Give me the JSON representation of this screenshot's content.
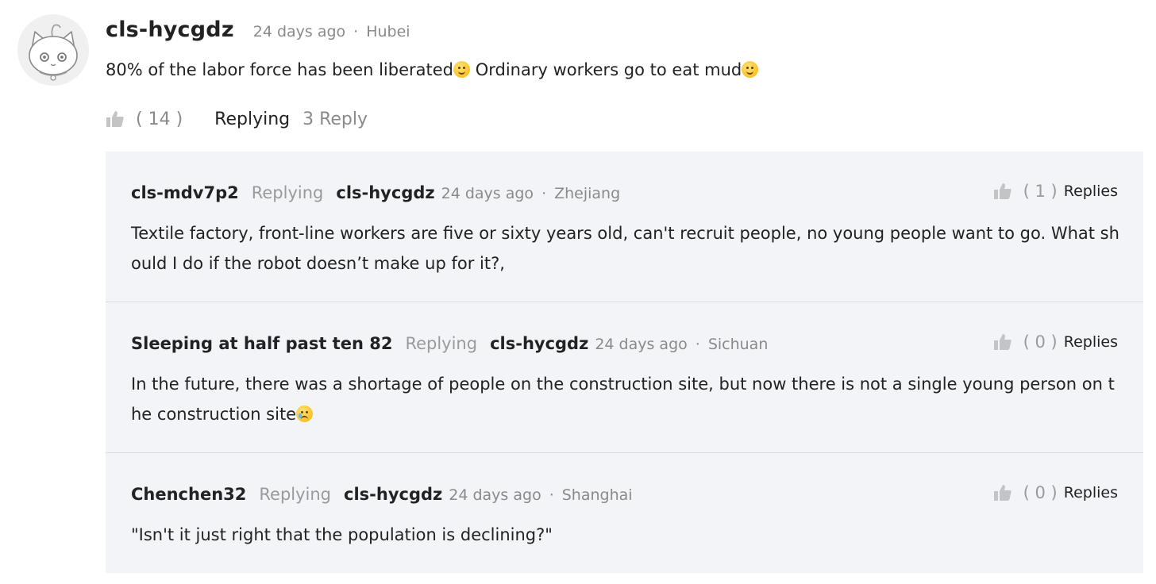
{
  "main_comment": {
    "username": "cls-hycgdz",
    "time": "24 days ago",
    "separator": "·",
    "location": "Hubei",
    "text_part1": "80% of the labor force has been liberated",
    "text_part2": " Ordinary workers go to eat mud",
    "like_count": "( 14 )",
    "replying_label": "Replying",
    "reply_count": "3 Reply"
  },
  "replies": [
    {
      "username": "cls-mdv7p2",
      "replying_label": "Replying",
      "target": "cls-hycgdz",
      "time": "24 days ago",
      "separator": "·",
      "location": "Zhejiang",
      "like_count": "( 1 )",
      "replies_label": "Replies",
      "text": "Textile factory, front-line workers are five or sixty years old, can't recruit people, no young people want to go. What should I do if the robot doesn’t make up for it?,"
    },
    {
      "username": "Sleeping at half past ten 82",
      "replying_label": "Replying",
      "target": "cls-hycgdz",
      "time": "24 days ago",
      "separator": "·",
      "location": "Sichuan",
      "like_count": "( 0 )",
      "replies_label": "Replies",
      "text": "In the future, there was a shortage of people on the construction site, but now there is not a single young person on the construction site"
    },
    {
      "username": "Chenchen32",
      "replying_label": "Replying",
      "target": "cls-hycgdz",
      "time": "24 days ago",
      "separator": "·",
      "location": "Shanghai",
      "like_count": "( 0 )",
      "replies_label": "Replies",
      "text": "\"Isn't it just right that the population is declining?\""
    }
  ],
  "icons": {
    "like": "thumbs-up-icon",
    "avatar": "cat-avatar-icon",
    "smile_emoji": "slight-smile-emoji-icon",
    "sad_emoji": "sad-tear-emoji-icon"
  },
  "colors": {
    "username": "#222222",
    "meta": "#8a8a8a",
    "replies_background": "#f3f4f8",
    "divider": "#dcdde2",
    "icon_gray": "#c4c4c4"
  }
}
